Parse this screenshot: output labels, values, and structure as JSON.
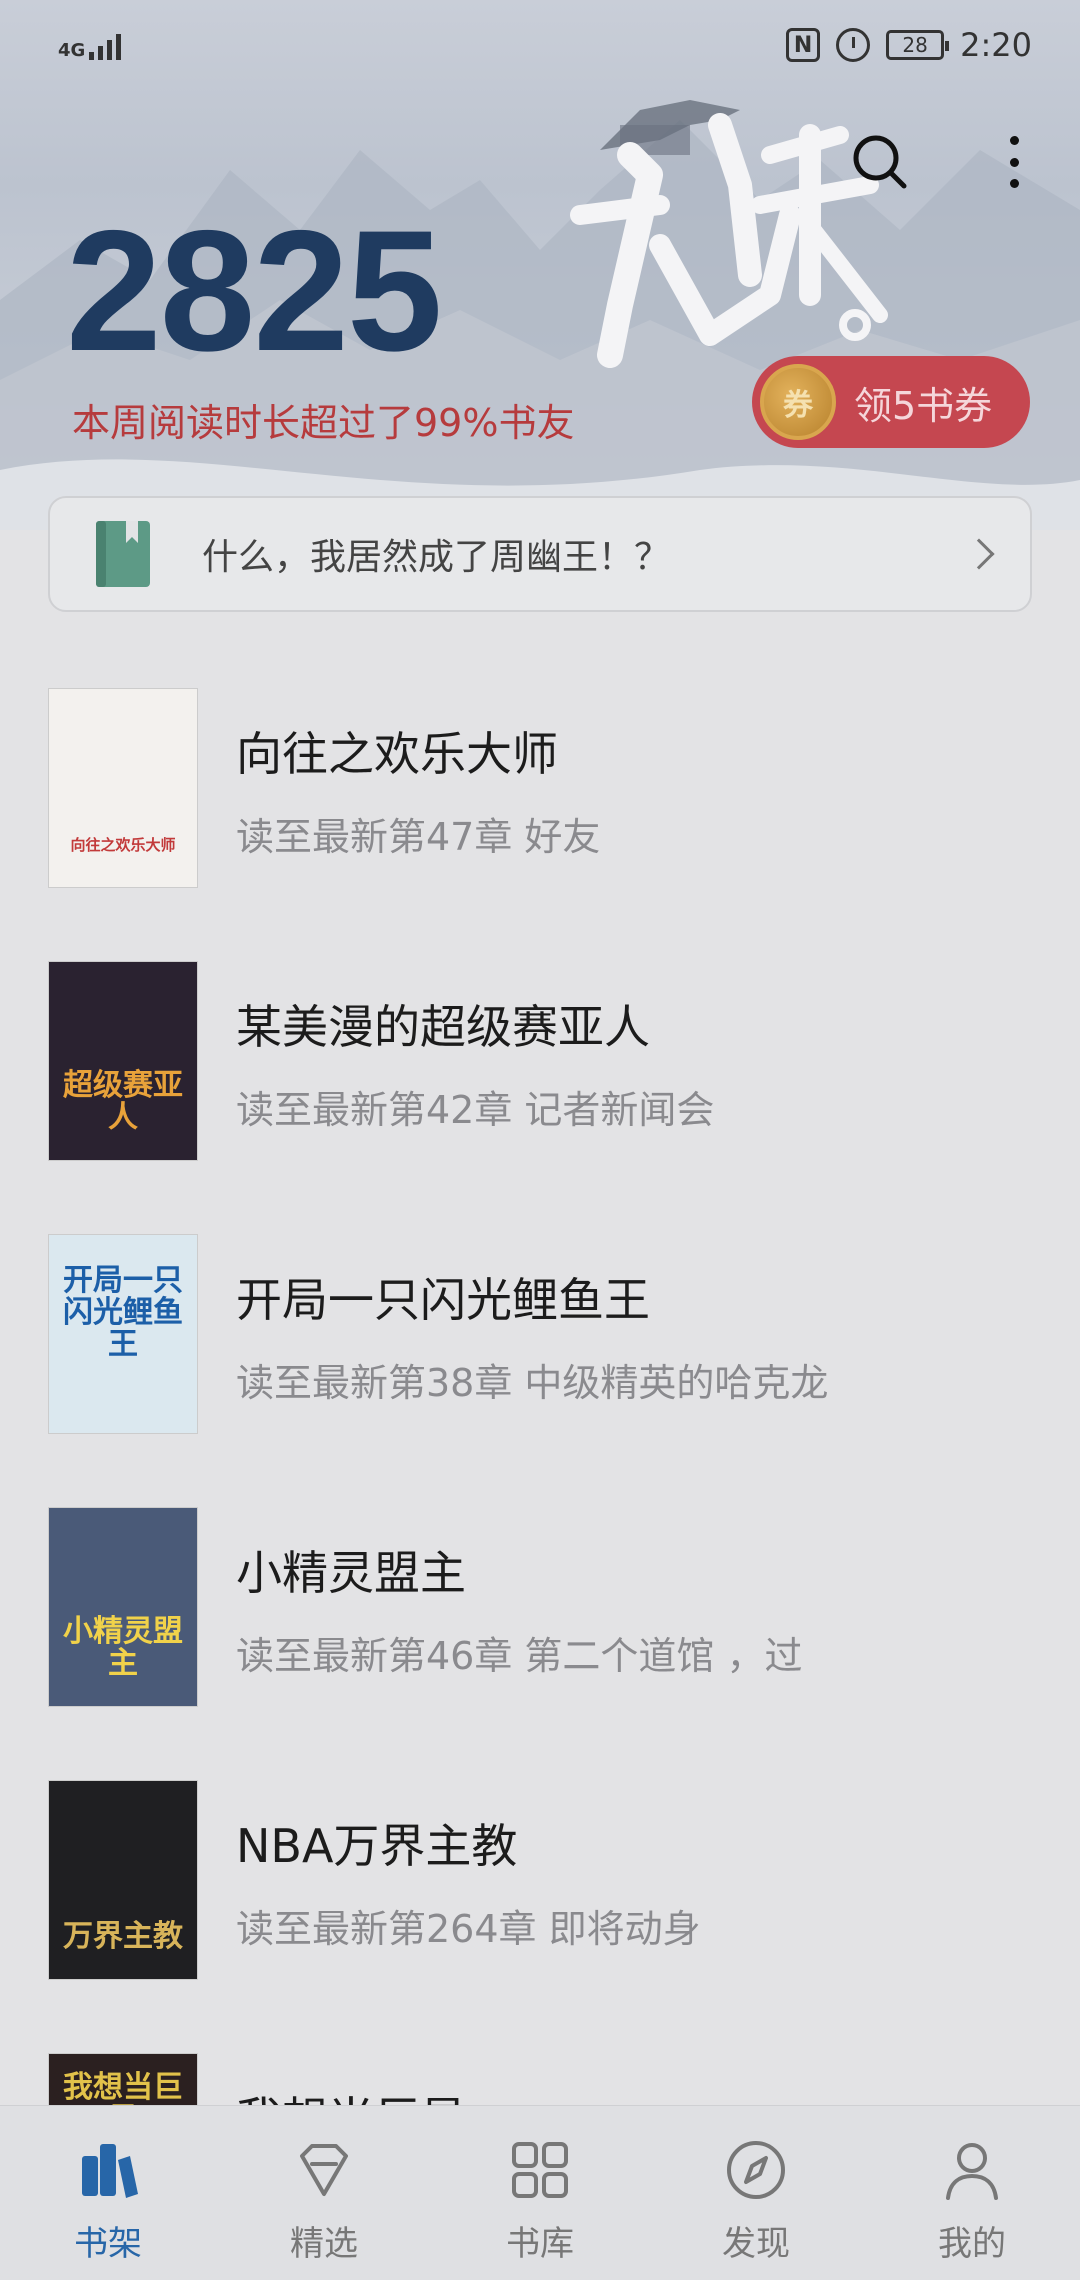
{
  "status_bar": {
    "network": "4G",
    "battery": "28",
    "time": "2:20"
  },
  "header": {
    "reading_minutes": "2825",
    "rank_text": "本周阅读时长超过了99%书友",
    "coupon_coin": "券",
    "coupon_label": "领5书券"
  },
  "notice": {
    "text": "什么，我居然成了周幽王！？"
  },
  "books": [
    {
      "title": "向往之欢乐大师",
      "progress": "读至最新第47章 好友",
      "cover_text": "向往之欢乐大师",
      "cover_bg": "#f3f1ee",
      "cover_fg": "#c23a3a"
    },
    {
      "title": "某美漫的超级赛亚人",
      "progress": "读至最新第42章 记者新闻会",
      "cover_text": "超级赛亚人",
      "cover_bg": "#2a2230",
      "cover_fg": "#e8a23a"
    },
    {
      "title": "开局一只闪光鲤鱼王",
      "progress": "读至最新第38章 中级精英的哈克龙",
      "cover_text": "开局一只闪光鲤鱼王",
      "cover_bg": "#dbe8ef",
      "cover_fg": "#1c5fa8"
    },
    {
      "title": "小精灵盟主",
      "progress": "读至最新第46章 第二个道馆 ，过",
      "cover_text": "小精灵盟主",
      "cover_bg": "#4a5a78",
      "cover_fg": "#f1d24a"
    },
    {
      "title": "NBA万界主教",
      "progress": "读至最新第264章 即将动身",
      "cover_text": "万界主教",
      "cover_bg": "#1f1f22",
      "cover_fg": "#d8b45a"
    },
    {
      "title": "我想当巨星",
      "progress": "",
      "cover_text": "我想当巨星",
      "cover_bg": "#2b2020",
      "cover_fg": "#e2c24a"
    }
  ],
  "tabs": [
    {
      "label": "书架",
      "icon": "bookshelf-icon",
      "active": true
    },
    {
      "label": "精选",
      "icon": "diamond-icon",
      "active": false
    },
    {
      "label": "书库",
      "icon": "grid-icon",
      "active": false
    },
    {
      "label": "发现",
      "icon": "compass-icon",
      "active": false
    },
    {
      "label": "我的",
      "icon": "person-icon",
      "active": false
    }
  ],
  "colors": {
    "accent": "#2766a8",
    "number": "#1f3b60",
    "rank_text": "#b63b3d",
    "coupon": "#c54750"
  }
}
